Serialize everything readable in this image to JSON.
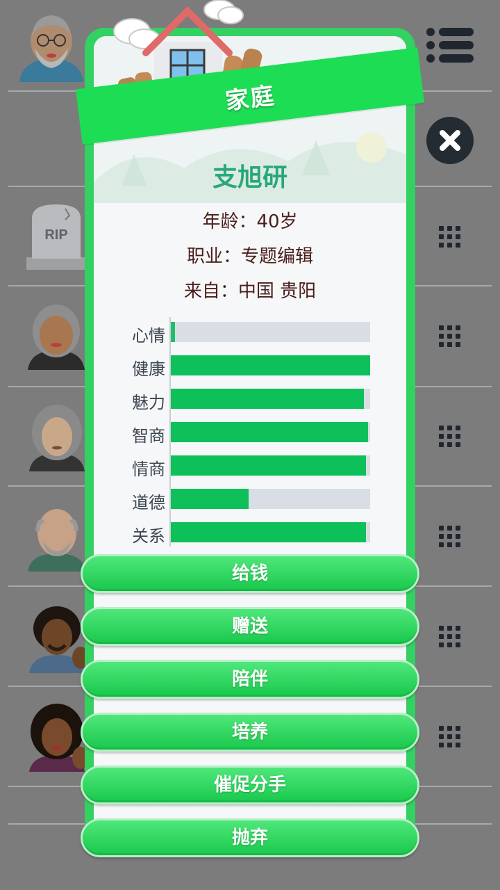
{
  "dialog": {
    "banner_title": "家庭",
    "person": {
      "name": "支旭研",
      "age_line": "年龄：40岁",
      "job_line": "职业：专题编辑",
      "origin_line": "来自：中国 贵阳"
    },
    "stats": [
      {
        "label": "心情",
        "value": 0.02
      },
      {
        "label": "健康",
        "value": 1.0
      },
      {
        "label": "魅力",
        "value": 0.97
      },
      {
        "label": "智商",
        "value": 0.99
      },
      {
        "label": "情商",
        "value": 0.98
      },
      {
        "label": "道德",
        "value": 0.39
      },
      {
        "label": "关系",
        "value": 0.98
      }
    ],
    "actions": [
      "给钱",
      "赠送",
      "陪伴",
      "培养",
      "催促分手",
      "抛弃"
    ]
  },
  "background": {
    "rip_text": "RIP"
  },
  "colors": {
    "stat_fill": "#0ec05a",
    "stat_fill_low": "#20c06a",
    "stat_track": "#d9dee4",
    "name": "#2aa877",
    "banner": "#1ddd55"
  },
  "icons": [
    "menu-icon",
    "close-icon",
    "grid-icon",
    "house-icon",
    "avatar"
  ]
}
